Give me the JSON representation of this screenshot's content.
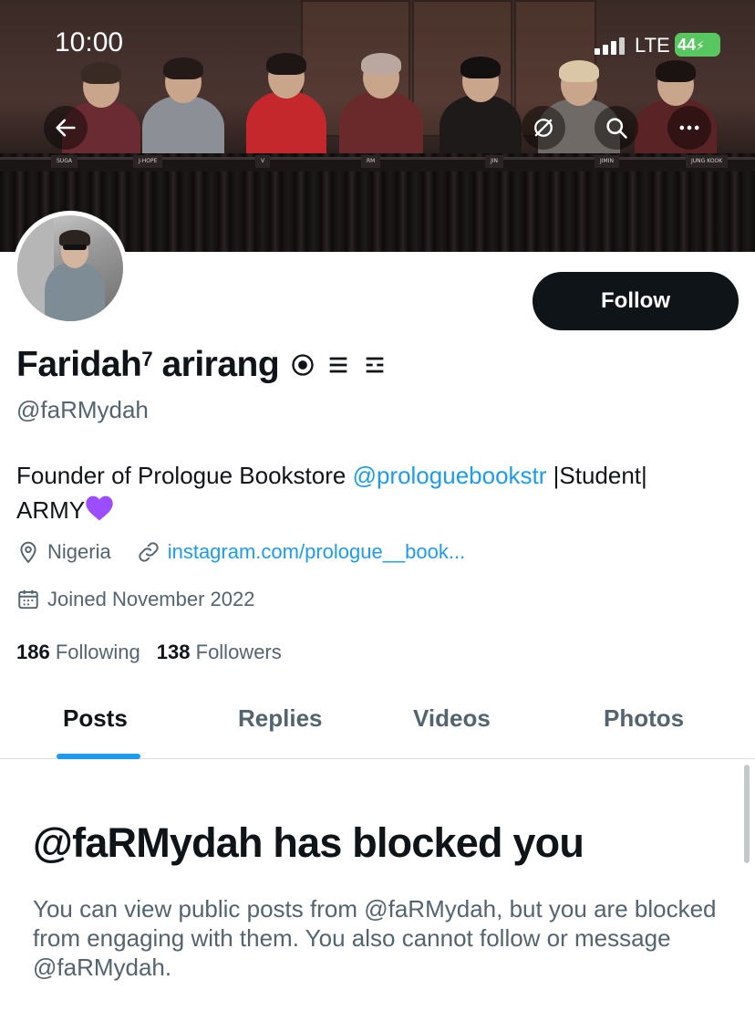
{
  "status_bar": {
    "time": "10:00",
    "network": "LTE",
    "battery": "44"
  },
  "header": {
    "back_icon": "arrow-left-icon",
    "translate_icon": "no-translate-icon",
    "search_icon": "search-icon",
    "more_icon": "ellipsis-icon",
    "banner_nameplates": [
      "SUGA",
      "J-HOPE",
      "V",
      "RM",
      "JIN",
      "JIMIN",
      "JUNG KOOK"
    ]
  },
  "profile": {
    "name": "Faridah",
    "name_sup": "7",
    "name_suffix": "arirang",
    "handle": "@faRMydah",
    "follow_label": "Follow",
    "bio_prefix": "Founder of Prologue Bookstore ",
    "bio_mention": "@prologuebookstr",
    "bio_suffix": " |Student|",
    "bio_line2": "ARMY",
    "location": "Nigeria",
    "website": "instagram.com/prologue__book...",
    "joined": "Joined November 2022",
    "following_count": "186",
    "following_label": "Following",
    "followers_count": "138",
    "followers_label": "Followers"
  },
  "tabs": [
    {
      "label": "Posts",
      "active": true
    },
    {
      "label": "Replies",
      "active": false
    },
    {
      "label": "Videos",
      "active": false
    },
    {
      "label": "Photos",
      "active": false
    }
  ],
  "blocked": {
    "title": "@faRMydah has blocked you",
    "body": "You can view public posts from @faRMydah, but you are blocked from engaging with them. You also cannot follow or message @faRMydah."
  },
  "colors": {
    "accent": "#1d9bf0",
    "text": "#0f1419",
    "secondary": "#536471",
    "battery": "#59c760",
    "heart": "#9b4dff"
  }
}
